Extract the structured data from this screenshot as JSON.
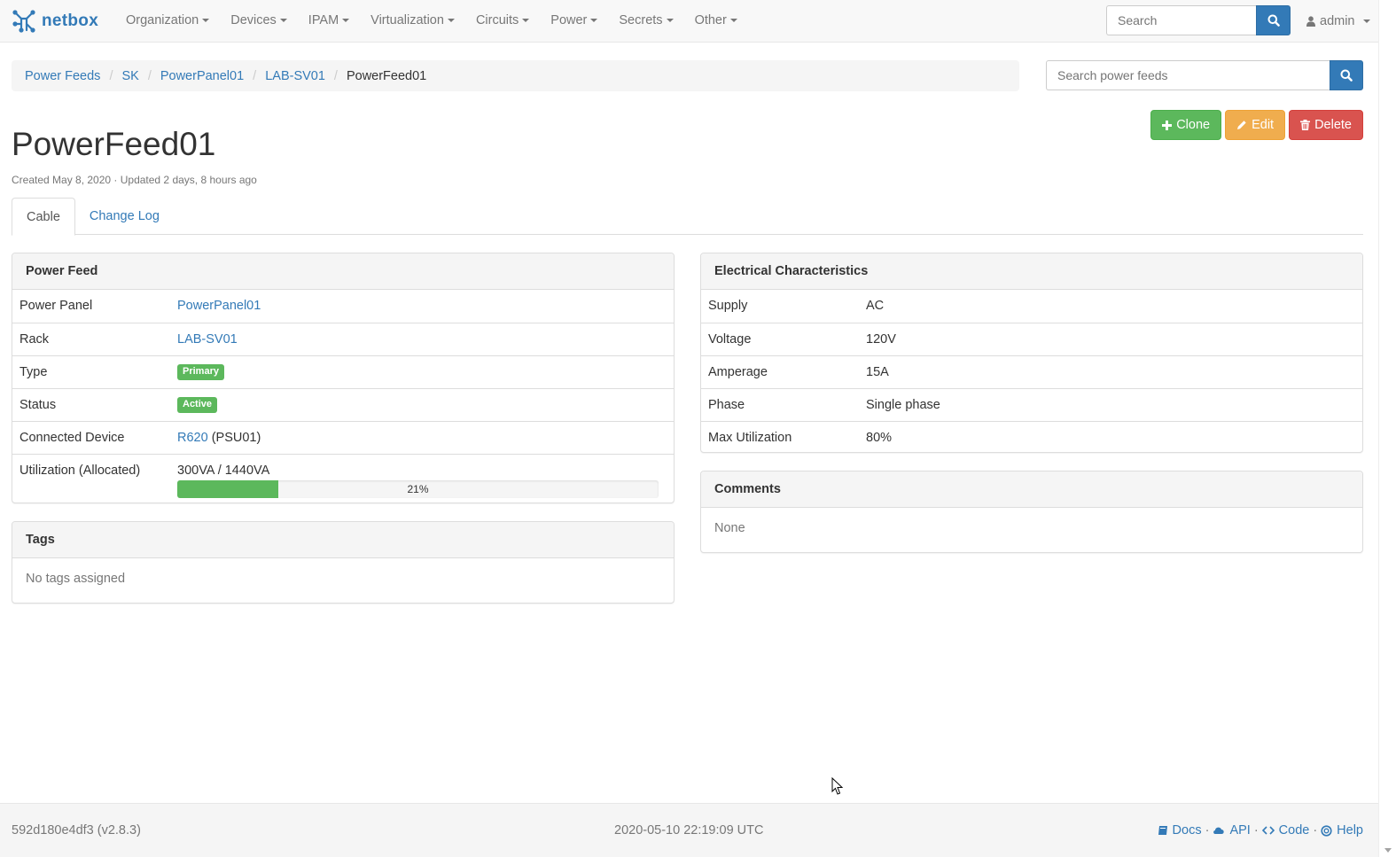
{
  "navbar": {
    "brand": "netbox",
    "menu": [
      {
        "label": "Organization"
      },
      {
        "label": "Devices"
      },
      {
        "label": "IPAM"
      },
      {
        "label": "Virtualization"
      },
      {
        "label": "Circuits"
      },
      {
        "label": "Power"
      },
      {
        "label": "Secrets"
      },
      {
        "label": "Other"
      }
    ],
    "search_placeholder": "Search",
    "user": "admin"
  },
  "breadcrumb": {
    "items": [
      "Power Feeds",
      "SK",
      "PowerPanel01",
      "LAB-SV01"
    ],
    "active": "PowerFeed01"
  },
  "feed_search_placeholder": "Search power feeds",
  "actions": {
    "clone": "Clone",
    "edit": "Edit",
    "delete": "Delete"
  },
  "page": {
    "title": "PowerFeed01",
    "meta": "Created May 8, 2020 · Updated 2 days, 8 hours ago"
  },
  "tabs": [
    {
      "label": "Cable",
      "active": true
    },
    {
      "label": "Change Log",
      "active": false
    }
  ],
  "power_feed": {
    "heading": "Power Feed",
    "power_panel_label": "Power Panel",
    "power_panel_value": "PowerPanel01",
    "rack_label": "Rack",
    "rack_value": "LAB-SV01",
    "type_label": "Type",
    "type_value": "Primary",
    "status_label": "Status",
    "status_value": "Active",
    "connected_label": "Connected Device",
    "connected_device": "R620",
    "connected_port": "(PSU01)",
    "utilization_label": "Utilization (Allocated)",
    "utilization_value": "300VA / 1440VA",
    "utilization_percent": 21,
    "utilization_text": "21%"
  },
  "tags": {
    "heading": "Tags",
    "empty": "No tags assigned"
  },
  "electrical": {
    "heading": "Electrical Characteristics",
    "rows": [
      {
        "label": "Supply",
        "value": "AC"
      },
      {
        "label": "Voltage",
        "value": "120V"
      },
      {
        "label": "Amperage",
        "value": "15A"
      },
      {
        "label": "Phase",
        "value": "Single phase"
      },
      {
        "label": "Max Utilization",
        "value": "80%"
      }
    ]
  },
  "comments": {
    "heading": "Comments",
    "body": "None"
  },
  "footer": {
    "version": "592d180e4df3 (v2.8.3)",
    "timestamp": "2020-05-10 22:19:09 UTC",
    "links": [
      "Docs",
      "API",
      "Code",
      "Help"
    ]
  },
  "colors": {
    "link": "#337ab7",
    "success": "#5cb85c",
    "warning": "#f0ad4e",
    "danger": "#d9534f"
  }
}
